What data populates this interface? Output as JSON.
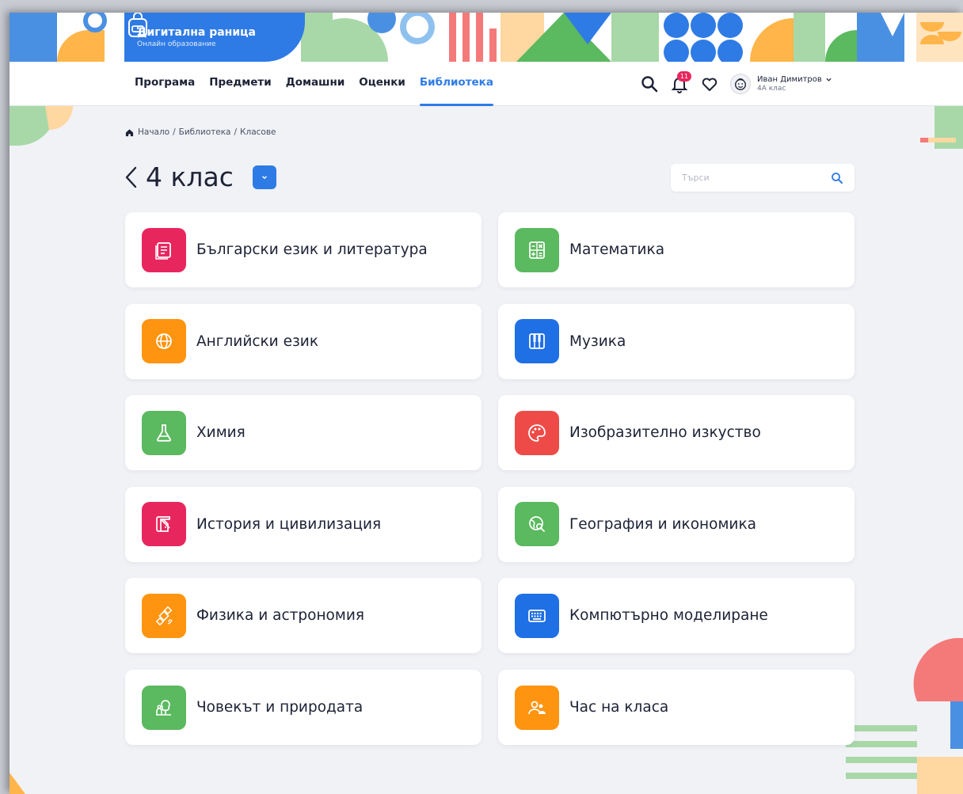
{
  "brand": {
    "title": "Дигитална раница",
    "subtitle": "Онлайн образование"
  },
  "nav": {
    "links": [
      {
        "label": "Програма"
      },
      {
        "label": "Предмети"
      },
      {
        "label": "Домашни"
      },
      {
        "label": "Оценки"
      },
      {
        "label": "Библиотека",
        "active": true
      }
    ],
    "notifications_count": "11",
    "user": {
      "name": "Иван Димитров",
      "class": "4А клас"
    }
  },
  "breadcrumb": [
    "Начало",
    "Библиотека",
    "Класове"
  ],
  "page_title": "4 клас",
  "search": {
    "placeholder": "Търси"
  },
  "subjects": [
    {
      "label": "Български език и литература",
      "icon": "book-icon",
      "color": "#e8265e"
    },
    {
      "label": "Математика",
      "icon": "calculator-icon",
      "color": "#5bb95f"
    },
    {
      "label": "Английски език",
      "icon": "globe-icon",
      "color": "#ff9410"
    },
    {
      "label": "Музика",
      "icon": "piano-icon",
      "color": "#1f6fe5"
    },
    {
      "label": "Химия",
      "icon": "flask-icon",
      "color": "#5bb95f"
    },
    {
      "label": "Изобразително изкуство",
      "icon": "palette-icon",
      "color": "#ee4b48"
    },
    {
      "label": "История и цивилизация",
      "icon": "scroll-icon",
      "color": "#e8265e"
    },
    {
      "label": "География и икономика",
      "icon": "globe-search-icon",
      "color": "#5bb95f"
    },
    {
      "label": "Физика и астрономия",
      "icon": "satellite-icon",
      "color": "#ff9410"
    },
    {
      "label": "Компютърно моделиране",
      "icon": "keyboard-icon",
      "color": "#1f6fe5"
    },
    {
      "label": "Човекът и природата",
      "icon": "nature-icon",
      "color": "#5bb95f"
    },
    {
      "label": "Час на класа",
      "icon": "people-icon",
      "color": "#ff9410"
    }
  ],
  "colors": {
    "accent": "#2f7be5",
    "text": "#1d2236",
    "background": "#f1f2f6"
  }
}
